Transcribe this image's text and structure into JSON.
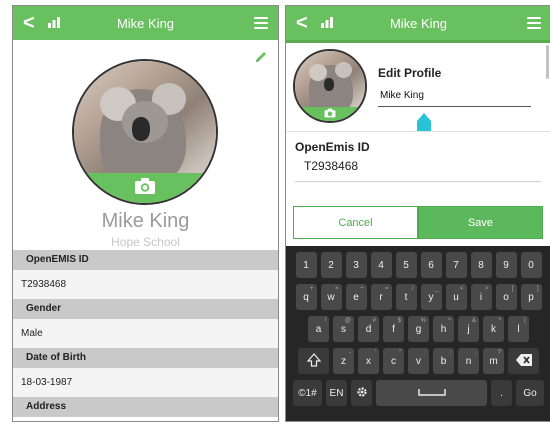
{
  "left": {
    "header": {
      "title": "Mike King"
    },
    "profile": {
      "name": "Mike King",
      "school": "Hope School"
    },
    "fields": [
      {
        "label": "OpenEMIS ID",
        "value": "T2938468"
      },
      {
        "label": "Gender",
        "value": "Male"
      },
      {
        "label": "Date of Birth",
        "value": "18-03-1987"
      },
      {
        "label": "Address",
        "value": ""
      }
    ]
  },
  "right": {
    "header": {
      "title": "Mike King"
    },
    "edit": {
      "title": "Edit Profile",
      "name_value": "Mike King"
    },
    "openemis": {
      "label": "OpenEmis ID",
      "value": "T2938468"
    },
    "buttons": {
      "cancel": "Cancel",
      "save": "Save"
    },
    "keyboard": {
      "row1": [
        "1",
        "2",
        "3",
        "4",
        "5",
        "6",
        "7",
        "8",
        "9",
        "0"
      ],
      "row2": [
        {
          "k": "q",
          "s": "+"
        },
        {
          "k": "w",
          "s": "×"
        },
        {
          "k": "e",
          "s": "÷"
        },
        {
          "k": "r",
          "s": "="
        },
        {
          "k": "t",
          "s": "/"
        },
        {
          "k": "y",
          "s": "_"
        },
        {
          "k": "u",
          "s": "<"
        },
        {
          "k": "i",
          "s": ">"
        },
        {
          "k": "o",
          "s": "["
        },
        {
          "k": "p",
          "s": "]"
        }
      ],
      "row3": [
        {
          "k": "a",
          "s": "!"
        },
        {
          "k": "s",
          "s": "@"
        },
        {
          "k": "d",
          "s": "#"
        },
        {
          "k": "f",
          "s": "$"
        },
        {
          "k": "g",
          "s": "%"
        },
        {
          "k": "h",
          "s": "^"
        },
        {
          "k": "j",
          "s": "&"
        },
        {
          "k": "k",
          "s": "*"
        },
        {
          "k": "l",
          "s": "("
        }
      ],
      "row4": [
        {
          "k": "z",
          "s": "-"
        },
        {
          "k": "x",
          "s": "'"
        },
        {
          "k": "c",
          "s": "\""
        },
        {
          "k": "v",
          "s": ":"
        },
        {
          "k": "b",
          "s": ";"
        },
        {
          "k": "n",
          "s": ","
        },
        {
          "k": "m",
          "s": "?"
        }
      ],
      "sym_label": "©1#",
      "lang_label": "EN",
      "period_label": ".",
      "go_label": "Go"
    }
  },
  "colors": {
    "brand_green": "#69c05f",
    "save_green": "#5cb85c",
    "cursor_cyan": "#27c4d6"
  }
}
